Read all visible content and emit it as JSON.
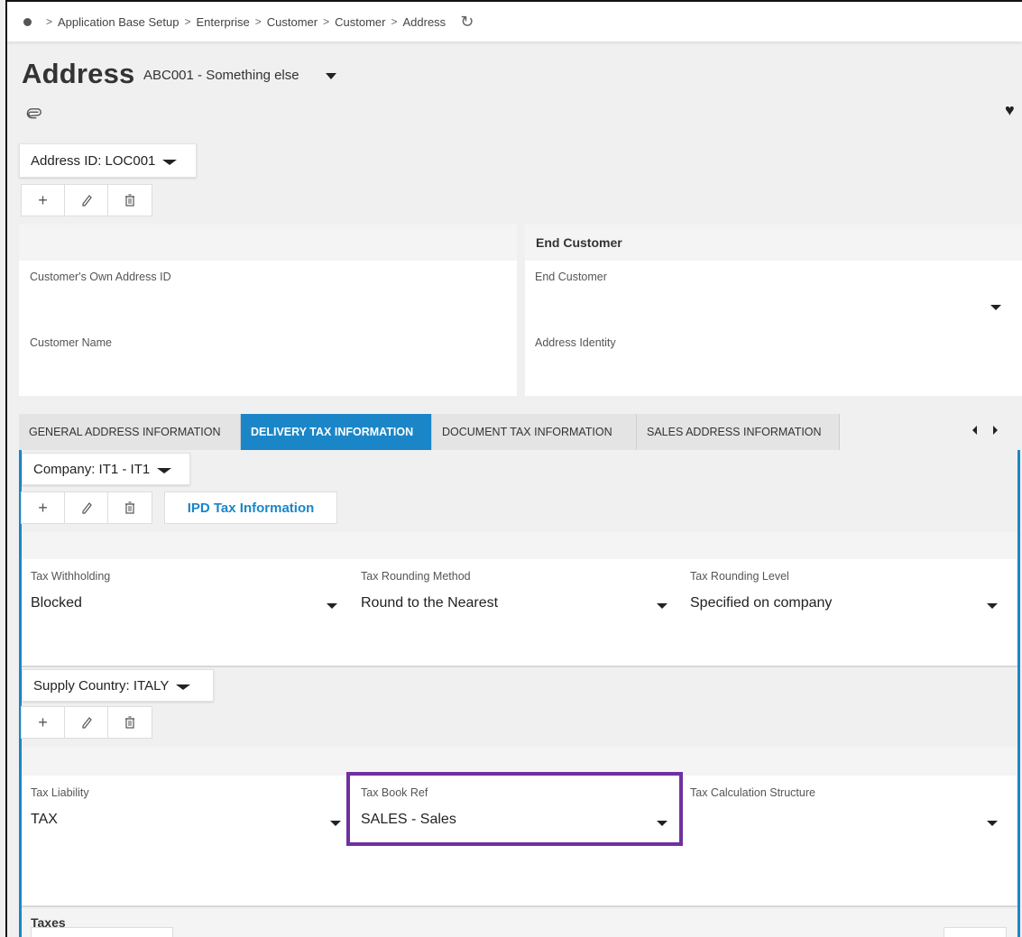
{
  "breadcrumb": {
    "items": [
      "Application Base Setup",
      "Enterprise",
      "Customer",
      "Customer",
      "Address"
    ],
    "separator": ">"
  },
  "header": {
    "title": "Address",
    "subtitle": "ABC001 - Something else"
  },
  "address_selector": {
    "label": "Address ID: LOC001"
  },
  "address_panel": {
    "left": {
      "fields": [
        {
          "label": "Customer's Own Address ID",
          "value": ""
        },
        {
          "label": "Customer Name",
          "value": ""
        }
      ]
    },
    "right": {
      "title": "End Customer",
      "fields": [
        {
          "label": "End Customer",
          "value": ""
        },
        {
          "label": "Address Identity",
          "value": ""
        }
      ]
    }
  },
  "tabs": [
    {
      "label": "GENERAL ADDRESS INFORMATION",
      "active": false
    },
    {
      "label": "DELIVERY TAX INFORMATION",
      "active": true
    },
    {
      "label": "DOCUMENT TAX INFORMATION",
      "active": false
    },
    {
      "label": "SALES ADDRESS INFORMATION",
      "active": false
    }
  ],
  "company_selector": {
    "label": "Company: IT1 - IT1"
  },
  "ipd_button": {
    "label": "IPD Tax Information"
  },
  "company_fields": [
    {
      "label": "Tax Withholding",
      "value": "Blocked"
    },
    {
      "label": "Tax Rounding Method",
      "value": "Round to the Nearest"
    },
    {
      "label": "Tax Rounding Level",
      "value": "Specified on company"
    }
  ],
  "supply_selector": {
    "label": "Supply Country: ITALY"
  },
  "supply_fields": [
    {
      "label": "Tax Liability",
      "value": "TAX"
    },
    {
      "label": "Tax Book Ref",
      "value": "SALES - Sales"
    },
    {
      "label": "Tax Calculation Structure",
      "value": ""
    }
  ],
  "taxes": {
    "title": "Taxes"
  },
  "colors": {
    "accent": "#1a86c8",
    "highlight": "#7030a0"
  },
  "icons": [
    "refresh-icon",
    "paperclip-icon",
    "heart-icon",
    "plus-icon",
    "pencil-icon",
    "trash-icon"
  ]
}
